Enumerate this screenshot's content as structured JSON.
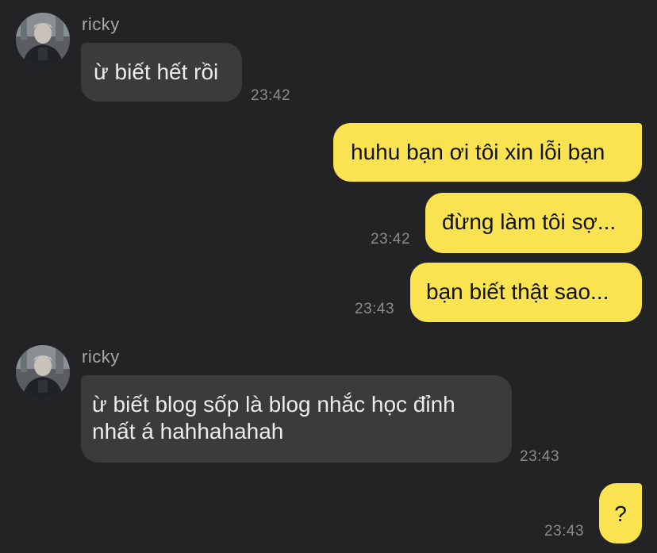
{
  "colors": {
    "background": "#232325",
    "incoming_bubble": "#3b3b3e",
    "outgoing_bubble": "#fae351",
    "timestamp": "#8c8c8f"
  },
  "messages": [
    {
      "direction": "incoming",
      "sender": "ricky",
      "text": "ừ biết hết rồi",
      "time": "23:42"
    },
    {
      "direction": "outgoing",
      "text": "huhu bạn ơi tôi xin lỗi bạn",
      "time": ""
    },
    {
      "direction": "outgoing",
      "text": "đừng làm tôi sợ...",
      "time": "23:42"
    },
    {
      "direction": "outgoing",
      "text": "bạn biết thật sao...",
      "time": "23:43"
    },
    {
      "direction": "incoming",
      "sender": "ricky",
      "text": "ừ biết blog sốp là blog nhắc học đỉnh nhất á hahhahahah",
      "time": "23:43"
    },
    {
      "direction": "outgoing",
      "text": "?",
      "time": "23:43"
    }
  ]
}
